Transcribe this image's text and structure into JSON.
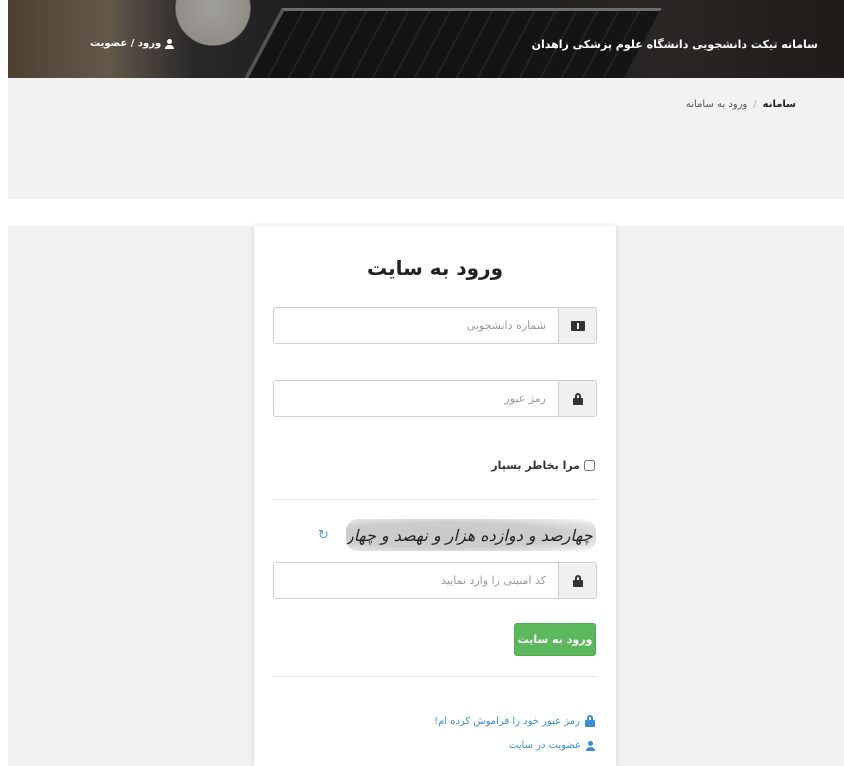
{
  "header": {
    "site_title": "سامانه تیکت دانشجویی دانشگاه علوم پزشکی زاهدان",
    "login_link": "ورود / عضویت",
    "login_icon": "user-icon"
  },
  "breadcrumb": {
    "home": "سامانه",
    "separator": "/",
    "current": "ورود به سامانه"
  },
  "login_form": {
    "title": "ورود به سایت",
    "student_number": {
      "value": "",
      "placeholder": "شماره دانشجویی",
      "icon": "ticket-icon"
    },
    "password": {
      "value": "",
      "placeholder": "رمز عبور",
      "icon": "lock-icon"
    },
    "remember_me": {
      "label": "مرا بخاطر بسپار",
      "checked": false
    },
    "captcha": {
      "text": "چهارصد و دوازده هزار و نهصد و چهار",
      "refresh_icon": "refresh-icon"
    },
    "security_code": {
      "value": "",
      "placeholder": "کد امنیتی را وارد نمایید",
      "icon": "lock-icon"
    },
    "submit_label": "ورود به سایت",
    "submit_color": "#5cb85c"
  },
  "links": {
    "forgot_password": "رمز عبور خود را فراموش کرده ام!",
    "register": "عضویت در سایت",
    "link_color": "#3a8fd6"
  }
}
